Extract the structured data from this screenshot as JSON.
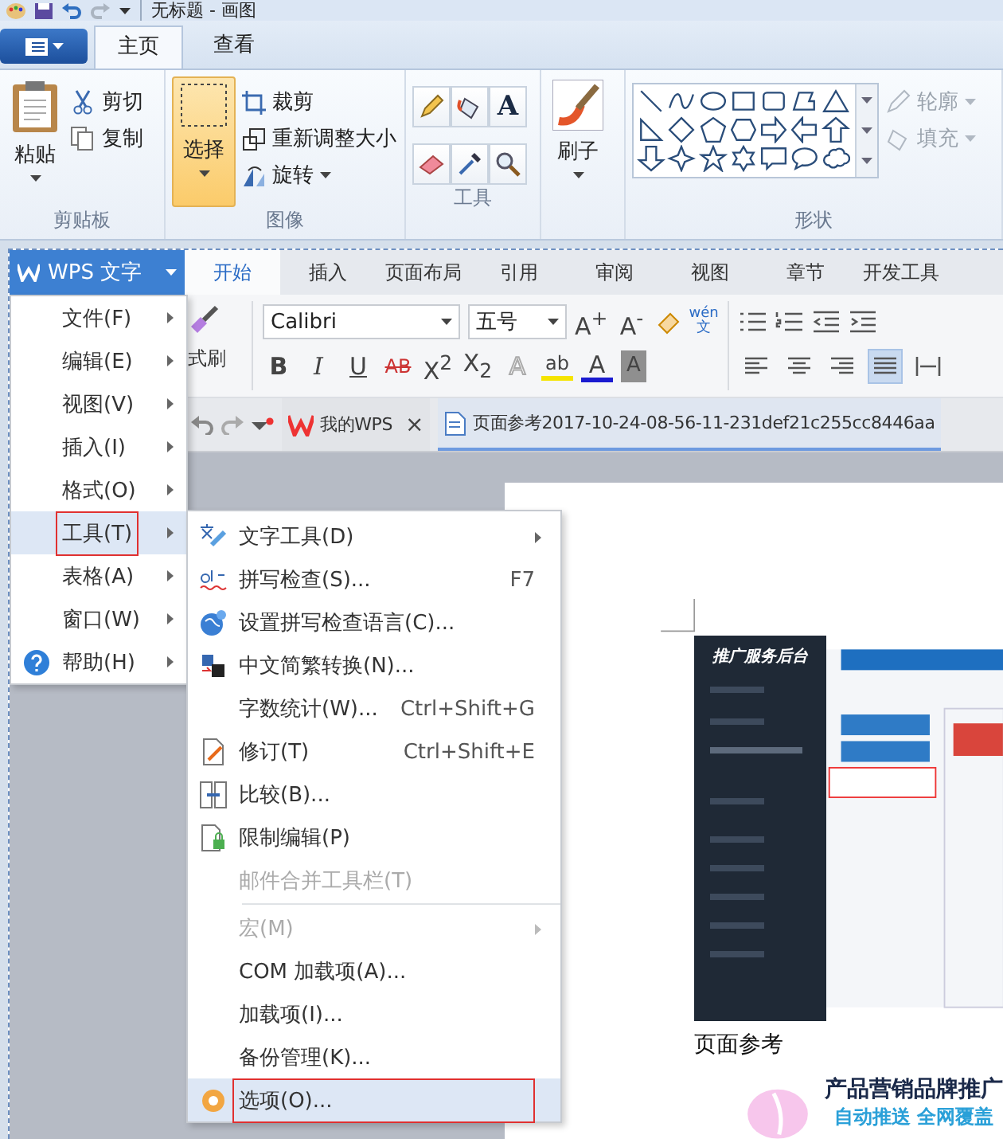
{
  "paint": {
    "title": "无标题 - 画图",
    "tabs": [
      {
        "label": "主页",
        "selected": true
      },
      {
        "label": "查看",
        "selected": false
      }
    ],
    "ribbon": {
      "clipboard": {
        "paste": "粘贴",
        "cut": "剪切",
        "copy": "复制",
        "label": "剪贴板"
      },
      "image": {
        "select": {
          "label": "选择",
          "selected": true
        },
        "crop": "裁剪",
        "resize": "重新调整大小",
        "rotate": "旋转",
        "label": "图像"
      },
      "tools": {
        "text_tool": "A",
        "label": "工具"
      },
      "brushes": {
        "label": "刷子"
      },
      "shapes": {
        "outline": {
          "label": "轮廓",
          "disabled": true
        },
        "fill": {
          "label": "填充",
          "disabled": true
        },
        "label": "形状"
      }
    }
  },
  "wps": {
    "app_button": "WPS 文字",
    "tabs": [
      {
        "label": "开始",
        "selected": true
      },
      {
        "label": "插入",
        "selected": false
      },
      {
        "label": "页面布局",
        "selected": false
      },
      {
        "label": "引用",
        "selected": false
      },
      {
        "label": "审阅",
        "selected": false
      },
      {
        "label": "视图",
        "selected": false
      },
      {
        "label": "章节",
        "selected": false
      },
      {
        "label": "开发工具",
        "selected": false
      }
    ],
    "toolbar": {
      "format_painter": "式刷",
      "font": "Calibri",
      "size": "五号",
      "size_buttons": [
        "A$^{+}$",
        "A$^{-}$"
      ],
      "phonetic": {
        "top": "wén",
        "bottom": "文"
      },
      "format_buttons": [
        {
          "kind": "bold",
          "label": "B"
        },
        {
          "kind": "italic",
          "label": "I"
        },
        {
          "kind": "underline",
          "label": "U"
        },
        {
          "kind": "strike",
          "label": "AB"
        },
        {
          "kind": "plain",
          "label": "X$^{2}$"
        },
        {
          "kind": "plain",
          "label": "X$_{2}$"
        },
        {
          "kind": "outline",
          "label": "A"
        },
        {
          "kind": "highlight",
          "label": "ab"
        },
        {
          "kind": "font_color",
          "label": "A"
        },
        {
          "kind": "shading",
          "label": "A"
        }
      ],
      "alignments": [
        {
          "selected": false
        },
        {
          "selected": false
        },
        {
          "selected": false
        },
        {
          "selected": true
        },
        {
          "selected": false
        }
      ]
    },
    "doc_tabs": [
      {
        "label": "我的WPS",
        "close": "×",
        "selected": false
      },
      {
        "label": "页面参考2017-10-24-08-56-11-231def21c255cc8446aa",
        "selected": true
      }
    ],
    "menu": [
      {
        "label": "文件(F)",
        "selected": false,
        "annotated": false
      },
      {
        "label": "编辑(E)",
        "selected": false,
        "annotated": false
      },
      {
        "label": "视图(V)",
        "selected": false,
        "annotated": false
      },
      {
        "label": "插入(I)",
        "selected": false,
        "annotated": false
      },
      {
        "label": "格式(O)",
        "selected": false,
        "annotated": false
      },
      {
        "label": "工具(T)",
        "selected": true,
        "annotated": true
      },
      {
        "label": "表格(A)",
        "selected": false,
        "annotated": false
      },
      {
        "label": "窗口(W)",
        "selected": false,
        "annotated": false
      },
      {
        "label": "帮助(H)",
        "selected": false,
        "annotated": false
      }
    ],
    "submenu": [
      [
        {
          "label": "文字工具(D)",
          "arrow": true,
          "disabled": false,
          "selected": false,
          "annotated": false
        },
        {
          "label": "拼写检查(S)...",
          "shortcut": "F7",
          "arrow": false,
          "disabled": false,
          "selected": false,
          "annotated": false
        },
        {
          "label": "设置拼写检查语言(C)...",
          "arrow": false,
          "disabled": false,
          "selected": false,
          "annotated": false
        },
        {
          "label": "中文简繁转换(N)...",
          "arrow": false,
          "disabled": false,
          "selected": false,
          "annotated": false
        },
        {
          "label": "字数统计(W)...",
          "shortcut": "Ctrl+Shift+G",
          "arrow": false,
          "disabled": false,
          "selected": false,
          "annotated": false
        },
        {
          "label": "修订(T)",
          "shortcut": "Ctrl+Shift+E",
          "arrow": false,
          "disabled": false,
          "selected": false,
          "annotated": false
        },
        {
          "label": "比较(B)...",
          "arrow": false,
          "disabled": false,
          "selected": false,
          "annotated": false
        },
        {
          "label": "限制编辑(P)",
          "arrow": false,
          "disabled": false,
          "selected": false,
          "annotated": false
        },
        {
          "label": "邮件合并工具栏(T)",
          "arrow": false,
          "disabled": true,
          "selected": false,
          "annotated": false
        }
      ],
      [
        {
          "label": "宏(M)",
          "arrow": true,
          "disabled": true,
          "selected": false,
          "annotated": false
        },
        {
          "label": "COM 加载项(A)...",
          "arrow": false,
          "disabled": false,
          "selected": false,
          "annotated": false
        },
        {
          "label": "加载项(I)...",
          "arrow": false,
          "disabled": false,
          "selected": false,
          "annotated": false
        },
        {
          "label": "备份管理(K)...",
          "arrow": false,
          "disabled": false,
          "selected": false,
          "annotated": false
        },
        {
          "label": "选项(O)...",
          "arrow": false,
          "disabled": false,
          "selected": true,
          "annotated": true
        }
      ]
    ],
    "document": {
      "embedded_title": "推广服务后台",
      "caption": "页面参考",
      "banner_title": "产品营销品牌推广",
      "banner_subtitle": "自动推送 全网覆盖"
    }
  }
}
